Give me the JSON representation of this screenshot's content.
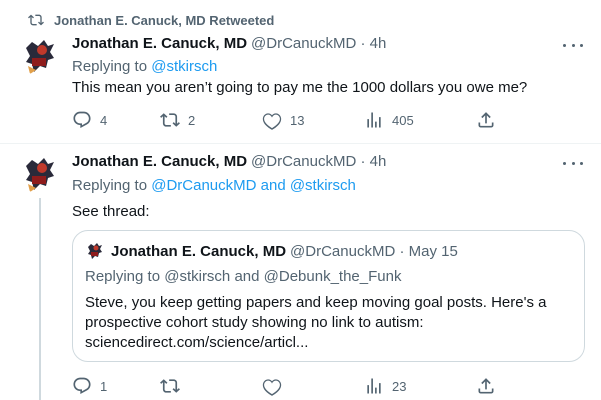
{
  "retweet": {
    "text": "Jonathan E. Canuck, MD Retweeted",
    "icon": "retweet-icon"
  },
  "tweets": [
    {
      "name": "Jonathan E. Canuck, MD",
      "handle": "@DrCanuckMD · 4h",
      "reply_prefix": "Replying to ",
      "reply_handles": "@stkirsch",
      "text": "This mean you aren’t going to pay me the 1000 dollars you owe me?",
      "actions": {
        "replies": "4",
        "retweets": "2",
        "likes": "13",
        "views": "405"
      }
    },
    {
      "name": "Jonathan E. Canuck, MD",
      "handle": "@DrCanuckMD · 4h",
      "reply_prefix": "Replying to ",
      "reply_handles": "@DrCanuckMD and @stkirsch",
      "text": "See thread:",
      "quote": {
        "name": "Jonathan E. Canuck, MD",
        "handle": "@DrCanuckMD · May 15",
        "reply_text": "Replying to @stkirsch and @Debunk_the_Funk",
        "body": "Steve, you keep getting papers and keep moving goal posts. Here's a prospective cohort study showing no link to autism: sciencedirect.com/science/articl..."
      },
      "actions": {
        "replies": "1",
        "retweets": "",
        "likes": "",
        "views": "23"
      }
    }
  ],
  "colors": {
    "accent": "#1d9bf0",
    "secondary_text": "#536471",
    "border": "#cfd9de"
  }
}
